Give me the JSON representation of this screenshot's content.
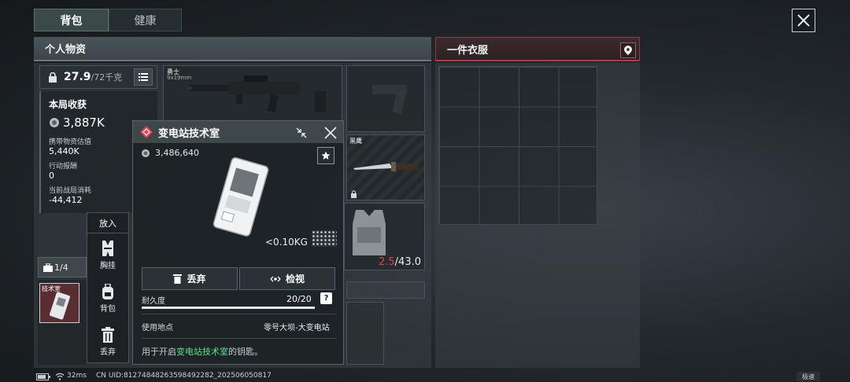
{
  "tabs": [
    {
      "label": "背包"
    },
    {
      "label": "健康"
    }
  ],
  "personal_panel": {
    "title": "个人物资",
    "weight_current": "27.9",
    "weight_max": "/72千克"
  },
  "stats": {
    "title": "本局收获",
    "harvest_value": "3,887K",
    "carried_label": "携带物资估值",
    "carried_value": "5,440K",
    "reward_label": "行动报酬",
    "reward_value": "0",
    "cost_label": "当前战局消耗",
    "cost_value": "-44,412"
  },
  "slots": {
    "rifle_label": "勇士",
    "rifle_caliber": "9x19mm",
    "knife_label": "黑鹰",
    "armor_durability_current": "2.5",
    "armor_durability_max": "/43.0",
    "keycase_count": "1/4",
    "keycase_item_label": "技术室"
  },
  "action_menu": {
    "title": "放入",
    "items": [
      {
        "label": "胸挂",
        "icon": "chest-rig-icon"
      },
      {
        "label": "背包",
        "icon": "backpack-icon"
      },
      {
        "label": "丢弃",
        "icon": "trash-icon"
      }
    ]
  },
  "item_popup": {
    "title": "变电站技术室",
    "price": "3,486,640",
    "weight": "<0.10KG",
    "discard_label": "丢弃",
    "inspect_label": "检视",
    "durability_label": "耐久度",
    "durability_value": "20/20",
    "durability_fraction": 1.0,
    "durability_help": "?",
    "location_label": "使用地点",
    "location_value": "零号大坝-大变电站",
    "desc_prefix": "用于开启",
    "desc_highlight": "变电站技术室",
    "desc_suffix": "的钥匙。"
  },
  "clothes_panel": {
    "title": "一件衣服"
  },
  "bottom_bar": {
    "ping": "32ms",
    "uid": "CN UID:812748482635984922​82_2025060508​17",
    "speed_btn": "极速"
  },
  "colors": {
    "accent_red": "#e0434f",
    "highlight_green": "#56e28c",
    "durability_red": "#e04646"
  }
}
